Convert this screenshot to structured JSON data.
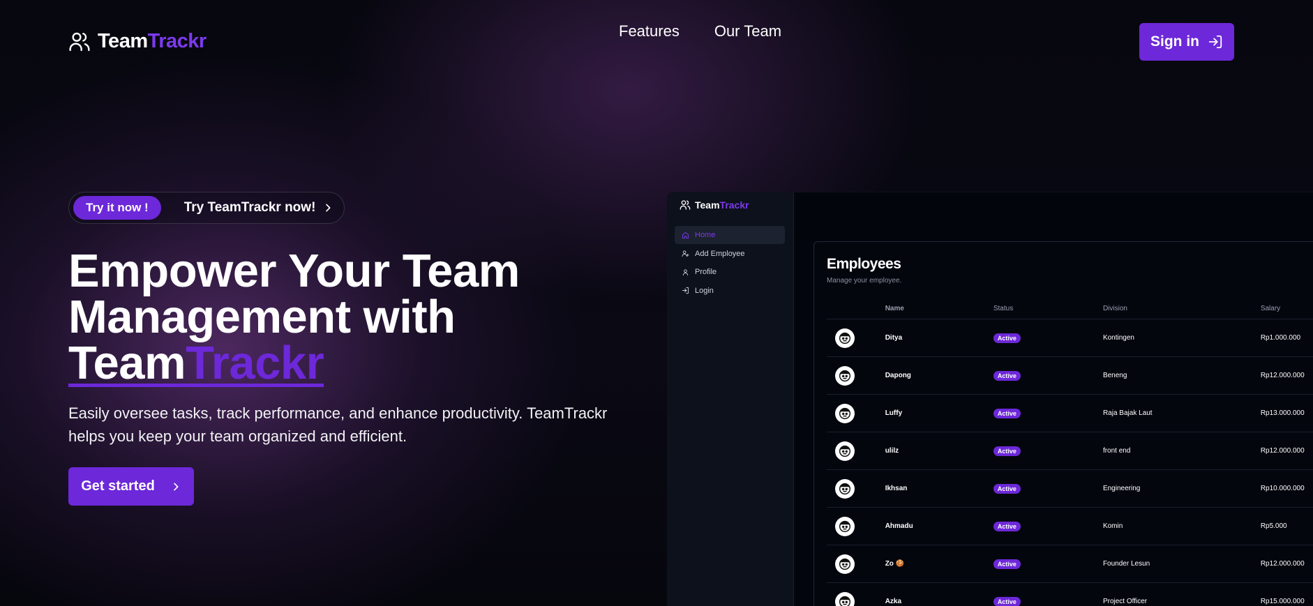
{
  "header": {
    "logo_team": "Team",
    "logo_trackr": "Trackr",
    "nav": [
      "Features",
      "Our Team"
    ],
    "signin_label": "Sign in"
  },
  "hero": {
    "pill_badge": "Try it now !",
    "pill_text": "Try TeamTrackr now!",
    "headline_line1": "Empower Your Team",
    "headline_line2": "Management with",
    "headline_brand_team": "Team",
    "headline_brand_trackr": "Trackr",
    "subtext": "Easily oversee tasks, track performance, and enhance productivity. TeamTrackr helps you keep your team organized and efficient.",
    "cta_label": "Get started"
  },
  "preview": {
    "logo_team": "Team",
    "logo_trackr": "Trackr",
    "menu": [
      {
        "label": "Home",
        "icon": "home-icon",
        "active": true
      },
      {
        "label": "Add Employee",
        "icon": "user-plus-icon",
        "active": false
      },
      {
        "label": "Profile",
        "icon": "user-icon",
        "active": false
      },
      {
        "label": "Login",
        "icon": "login-icon",
        "active": false
      }
    ],
    "title": "Employees",
    "subtitle": "Manage your employee.",
    "columns": [
      "Name",
      "Status",
      "Division",
      "Salary"
    ],
    "rows": [
      {
        "name": "Ditya",
        "status": "Active",
        "division": "Kontingen",
        "salary": "Rp1.000.000"
      },
      {
        "name": "Dapong",
        "status": "Active",
        "division": "Beneng",
        "salary": "Rp12.000.000"
      },
      {
        "name": "Luffy",
        "status": "Active",
        "division": "Raja Bajak Laut",
        "salary": "Rp13.000.000"
      },
      {
        "name": "ulilz",
        "status": "Active",
        "division": "front end",
        "salary": "Rp12.000.000"
      },
      {
        "name": "Ikhsan",
        "status": "Active",
        "division": "Engineering",
        "salary": "Rp10.000.000"
      },
      {
        "name": "Ahmadu",
        "status": "Active",
        "division": "Komin",
        "salary": "Rp5.000"
      },
      {
        "name": "Zo 🍪",
        "status": "Active",
        "division": "Founder Lesun",
        "salary": "Rp12.000.000"
      },
      {
        "name": "Azka",
        "status": "Active",
        "division": "Project Officer",
        "salary": "Rp15.000.000"
      }
    ]
  },
  "colors": {
    "accent": "#6d28d9",
    "background": "#05060f"
  }
}
